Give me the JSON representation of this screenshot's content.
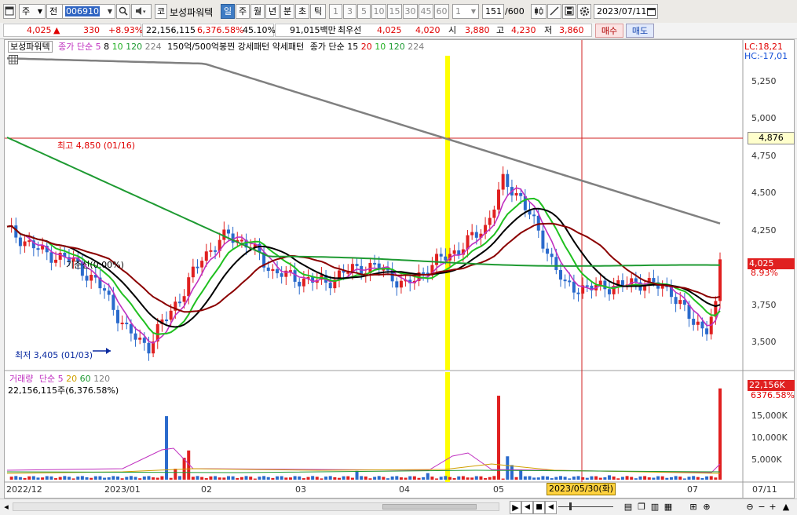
{
  "toolbar": {
    "market": "주",
    "scope": "전",
    "stock_code": "006910",
    "code_prefix": "코",
    "stock_name": "보성파워텍",
    "periods": [
      "일",
      "주",
      "월",
      "년",
      "분",
      "초",
      "틱"
    ],
    "selected_period": "일",
    "intervals": [
      "1",
      "3",
      "5",
      "10",
      "15",
      "30",
      "45",
      "60"
    ],
    "count": "1",
    "view_count": "151",
    "view_total": "/600",
    "date": "2023/07/11"
  },
  "quote": {
    "price": "4,025",
    "change_arrow": "▲",
    "change": "330",
    "change_pct": "+8.93%",
    "volume": "22,156,115",
    "volume_ratio": "6,376.58%",
    "turnover": "45.10%",
    "amount": "91,015백만",
    "bid_label": "최우선",
    "best_ask": "4,025",
    "best_bid": "4,020",
    "open_label": "시",
    "open": "3,880",
    "high_label": "고",
    "high": "4,230",
    "low_label": "저",
    "low": "3,860",
    "buy_label": "매수",
    "sell_label": "매도"
  },
  "price_panel": {
    "legend": {
      "name": "보성파워텍",
      "ma_label": "종가 단순",
      "ma_periods": [
        "5",
        "8",
        "10",
        "120",
        "224"
      ],
      "extra": "150억/500억봉찐  강세패턴  약세패턴",
      "ma2_label": "종가 단순",
      "ma2_periods": [
        "15",
        "20",
        "10",
        "120",
        "224"
      ]
    },
    "lc_label": "LC:18,21",
    "hc_label": "HC:-17,01",
    "y_ticks": [
      "5,250",
      "5,000",
      "4,750",
      "4,500",
      "4,250",
      "4,000",
      "3,750",
      "3,500"
    ],
    "high_annotation": "최고 4,850 (01/16)",
    "low_annotation": "최저 3,405 (01/03)",
    "ref_label": "기준선(0.00%)",
    "crosshair_price": "4,876",
    "last_price_tag": "4,025",
    "last_pct_tag": "8.93%"
  },
  "volume_panel": {
    "legend_label": "거래량",
    "ma_label": "단순",
    "ma_periods": [
      "5",
      "20",
      "60",
      "120"
    ],
    "summary": "22,156,115주(6,376.58%)",
    "y_ticks": [
      "15,000K",
      "10,000K",
      "5,000K"
    ],
    "last_tag": "22,156K",
    "last_pct": "6376.58%"
  },
  "x_axis": {
    "labels": [
      "2022/12",
      "2023/01",
      "02",
      "03",
      "04",
      "05",
      "07",
      "07/11"
    ],
    "crosshair_date": "2023/05/30(화)"
  },
  "colors": {
    "up": "#e02020",
    "down": "#2a6acc",
    "ma5": "#c030c0",
    "ma10": "#20c020",
    "ma20": "#000000",
    "ma60": "#8b0000",
    "ma120": "#1e9a32",
    "ma224": "#808080",
    "highlight": "#ffff00"
  }
}
